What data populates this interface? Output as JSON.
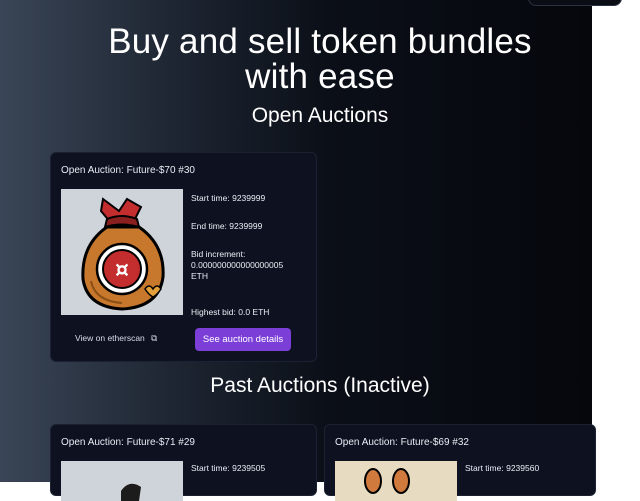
{
  "hero": {
    "title_line1": "Buy and sell token bundles",
    "title_line2": "with ease"
  },
  "sections": {
    "open": "Open Auctions",
    "past": "Past Auctions (Inactive)"
  },
  "open_auction": {
    "title": "Open Auction: Future-$70 #30",
    "start": "Start time: 9239999",
    "end": "End time: 9239999",
    "bid_inc_label": "Bid increment:",
    "bid_inc_value": "0.000000000000000005",
    "bid_inc_unit": "ETH",
    "highest_bid": "Highest bid: 0.0 ETH",
    "etherscan": "View on etherscan",
    "details_button": "See auction details"
  },
  "past_auctions": [
    {
      "title": "Open Auction: Future-$71 #29",
      "start": "Start time: 9239505"
    },
    {
      "title": "Open Auction: Future-$69 #32",
      "start": "Start time: 9239560"
    }
  ],
  "colors": {
    "accent": "#7b3fd8",
    "card_bg": "#0e1220"
  },
  "icons": {
    "external_link": "external-link-icon",
    "token_bag": "money-bag-image"
  }
}
